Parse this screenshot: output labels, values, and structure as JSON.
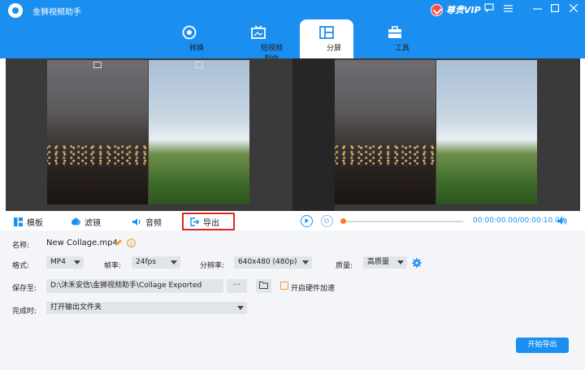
{
  "app": {
    "title": "金狮视频助手",
    "vip_label": "尊贵VIP"
  },
  "nav": {
    "tabs": [
      {
        "label": "转换",
        "icon": "convert-icon"
      },
      {
        "label": "短视频制作",
        "icon": "short-video-icon"
      },
      {
        "label": "分屏",
        "icon": "split-screen-icon",
        "active": true
      },
      {
        "label": "工具",
        "icon": "toolbox-icon"
      }
    ]
  },
  "toolbar": {
    "template_label": "模板",
    "filter_label": "滤镜",
    "audio_label": "音频",
    "export_label": "导出",
    "time_display": "00:00:00.00/00:00:10.09",
    "progress": 0.0
  },
  "settings": {
    "name_label": "名称:",
    "name_value": "New Collage.mp4",
    "format_label": "格式:",
    "format_value": "MP4",
    "framerate_label": "帧率:",
    "framerate_value": "24fps",
    "resolution_label": "分辨率:",
    "resolution_value": "640x480 (480p)",
    "quality_label": "质量:",
    "quality_value": "高质量",
    "save_to_label": "保存至:",
    "save_path": "D:\\沐禾安信\\金狮视频助手\\Collage Exported",
    "browse_label": "···",
    "hw_accel_label": "开启硬件加速",
    "hw_accel_checked": false,
    "on_complete_label": "完成时:",
    "on_complete_value": "打开输出文件夹",
    "start_export_label": "开始导出"
  },
  "colors": {
    "accent": "#1a8ff0",
    "highlight": "#e02525",
    "progress_dot": "#ff7a2a"
  }
}
